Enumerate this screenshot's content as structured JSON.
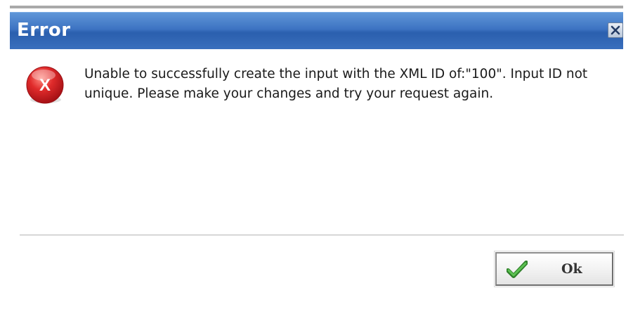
{
  "dialog": {
    "title": "Error",
    "message": "Unable to successfully create the input with the XML ID of:\"100\". Input ID not unique. Please make your changes and try your request again.",
    "error_icon_letter": "X",
    "ok_label": "Ok",
    "icons": {
      "close": "close-icon",
      "error": "error-icon",
      "ok": "checkmark-icon"
    },
    "colors": {
      "titlebar": "#3d73c2",
      "error_red": "#d2202a",
      "check_green": "#3fa23a"
    }
  }
}
